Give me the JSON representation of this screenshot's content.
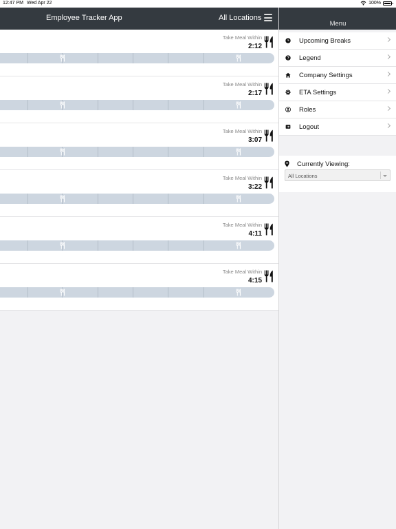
{
  "status_bar": {
    "time": "12:47 PM",
    "date": "Wed Apr 22",
    "battery": "100%"
  },
  "navbar": {
    "title": "Employee Tracker App",
    "location": "All Locations"
  },
  "rows": [
    {
      "label": "Take Meal Within",
      "time": "2:12"
    },
    {
      "label": "Take Meal Within",
      "time": "2:17"
    },
    {
      "label": "Take Meal Within",
      "time": "3:07"
    },
    {
      "label": "Take Meal Within",
      "time": "3:22"
    },
    {
      "label": "Take Meal Within",
      "time": "4:11"
    },
    {
      "label": "Take Meal Within",
      "time": "4:15"
    }
  ],
  "sidebar": {
    "title": "Menu",
    "items": [
      {
        "label": "Upcoming Breaks",
        "icon": "clock-icon"
      },
      {
        "label": "Legend",
        "icon": "question-icon"
      },
      {
        "label": "Company Settings",
        "icon": "home-icon"
      },
      {
        "label": "ETA Settings",
        "icon": "gear-icon"
      },
      {
        "label": "Roles",
        "icon": "user-icon"
      },
      {
        "label": "Logout",
        "icon": "logout-icon"
      }
    ],
    "viewing_label": "Currently Viewing:",
    "viewing_value": "All Locations"
  },
  "colors": {
    "navbar": "#343a40",
    "timeline": "#cdd6e0",
    "background": "#f2f2f4"
  }
}
